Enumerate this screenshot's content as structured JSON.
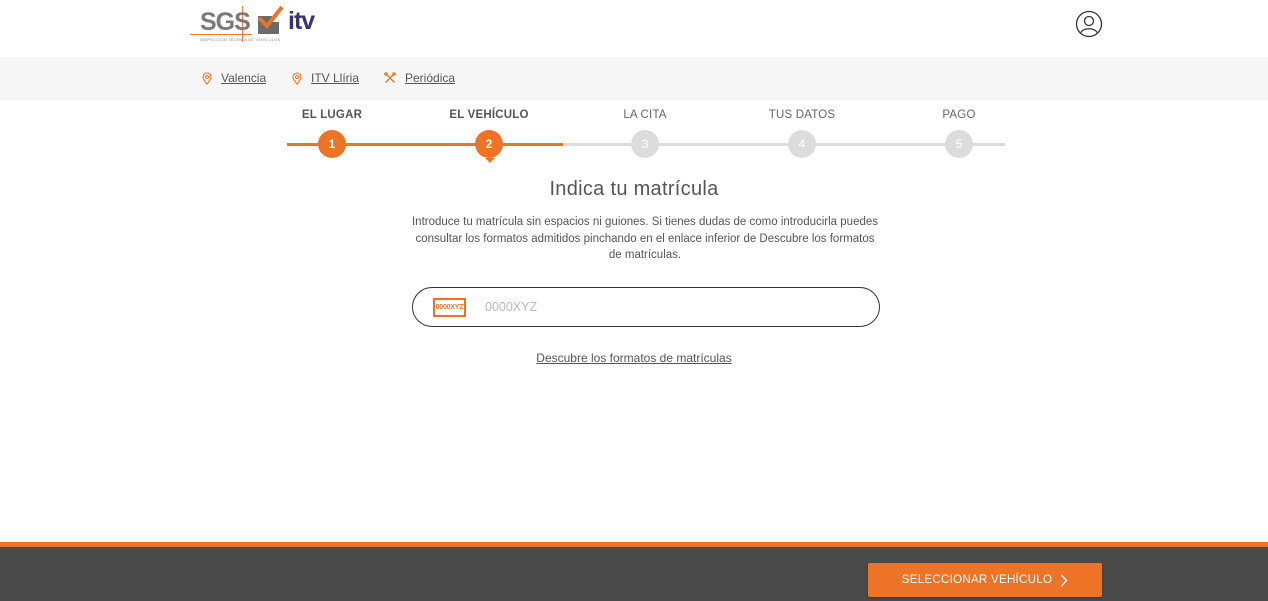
{
  "brand": {
    "sgs": "SGS",
    "tagline": "INSPECCIÓN TÉCNICA DE VEHÍCULOS",
    "itv": "itv",
    "accent": "#ed7326",
    "itv_color": "#3b3371"
  },
  "header": {
    "user_icon": "user-circle-icon"
  },
  "breadcrumb": {
    "items": [
      {
        "label": "Valencia",
        "icon": "map-pin-icon"
      },
      {
        "label": "ITV Llíria",
        "icon": "map-pin-icon"
      },
      {
        "label": "Periódica",
        "icon": "tools-icon"
      }
    ]
  },
  "stepper": {
    "steps": [
      {
        "label": "EL LUGAR",
        "number": "1",
        "state": "done"
      },
      {
        "label": "EL VEHÍCULO",
        "number": "2",
        "state": "current"
      },
      {
        "label": "LA CITA",
        "number": "3",
        "state": "pending"
      },
      {
        "label": "TUS DATOS",
        "number": "4",
        "state": "pending"
      },
      {
        "label": "PAGO",
        "number": "5",
        "state": "pending"
      }
    ]
  },
  "main": {
    "title": "Indica tu matrícula",
    "description": "Introduce tu matrícula sin espacios ni guiones. Si tienes dudas de como introducirla puedes consultar los formatos admitidos pinchando en el enlace inferior de Descubre los formatos de matrículas.",
    "plate_icon_text": "0000XYZ",
    "plate_placeholder": "0000XYZ",
    "plate_value": "",
    "formats_link": "Descubre los formatos de matrículas"
  },
  "footer": {
    "cta_label": "SELECCIONAR VEHÍCULO",
    "cta_icon": "chevron-right-icon"
  }
}
